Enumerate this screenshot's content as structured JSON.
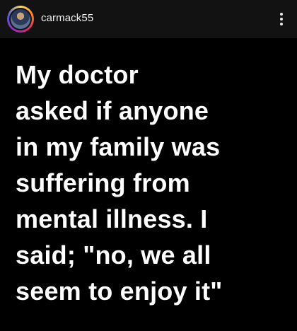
{
  "header": {
    "username": "carmack55",
    "avatar_icon": "profile-photo",
    "more_icon": "vertical-ellipsis"
  },
  "post": {
    "lines": [
      "My doctor",
      "asked if anyone",
      "in my family was",
      "suffering from",
      "mental illness. I",
      "said; \"no, we all",
      "seem to enjoy it\""
    ]
  },
  "colors": {
    "header_bg": "#121212",
    "post_bg": "#000000",
    "text": "#ffffff"
  }
}
